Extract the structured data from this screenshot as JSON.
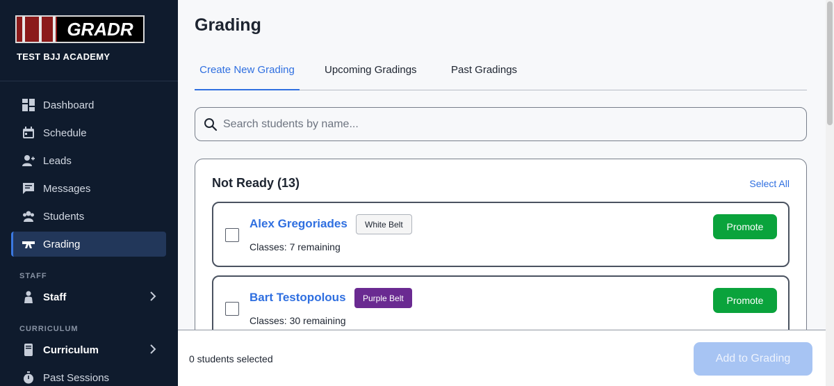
{
  "brand": {
    "logo_text": "GRADR",
    "academy_name": "TEST BJJ ACADEMY"
  },
  "sidebar": {
    "items": [
      {
        "label": "Dashboard",
        "icon": "dashboard-icon"
      },
      {
        "label": "Schedule",
        "icon": "calendar-icon"
      },
      {
        "label": "Leads",
        "icon": "add-user-icon"
      },
      {
        "label": "Messages",
        "icon": "message-icon"
      },
      {
        "label": "Students",
        "icon": "students-icon"
      },
      {
        "label": "Grading",
        "icon": "belt-icon",
        "active": true
      }
    ],
    "staff_section": {
      "label": "STAFF",
      "item": "Staff"
    },
    "curriculum_section": {
      "label": "CURRICULUM",
      "item": "Curriculum"
    },
    "past_sessions": "Past Sessions"
  },
  "main": {
    "title": "Grading",
    "tabs": [
      {
        "label": "Create New Grading",
        "active": true
      },
      {
        "label": "Upcoming Gradings"
      },
      {
        "label": "Past Gradings"
      }
    ],
    "search": {
      "placeholder": "Search students by name..."
    },
    "panel": {
      "title": "Not Ready (13)",
      "select_all": "Select All",
      "students": [
        {
          "name": "Alex Gregoriades",
          "belt": "White Belt",
          "classes": "Classes: 7 remaining",
          "action": "Promote"
        },
        {
          "name": "Bart Testopolous",
          "belt": "Purple Belt",
          "classes": "Classes: 30 remaining",
          "action": "Promote"
        }
      ]
    }
  },
  "footer": {
    "selected": "0 students selected",
    "add_button": "Add to Grading"
  },
  "colors": {
    "sidebar_bg": "#0f1b2d",
    "accent": "#2f6fe0",
    "promote": "#0aa33c",
    "purple_belt": "#6a2a91"
  }
}
